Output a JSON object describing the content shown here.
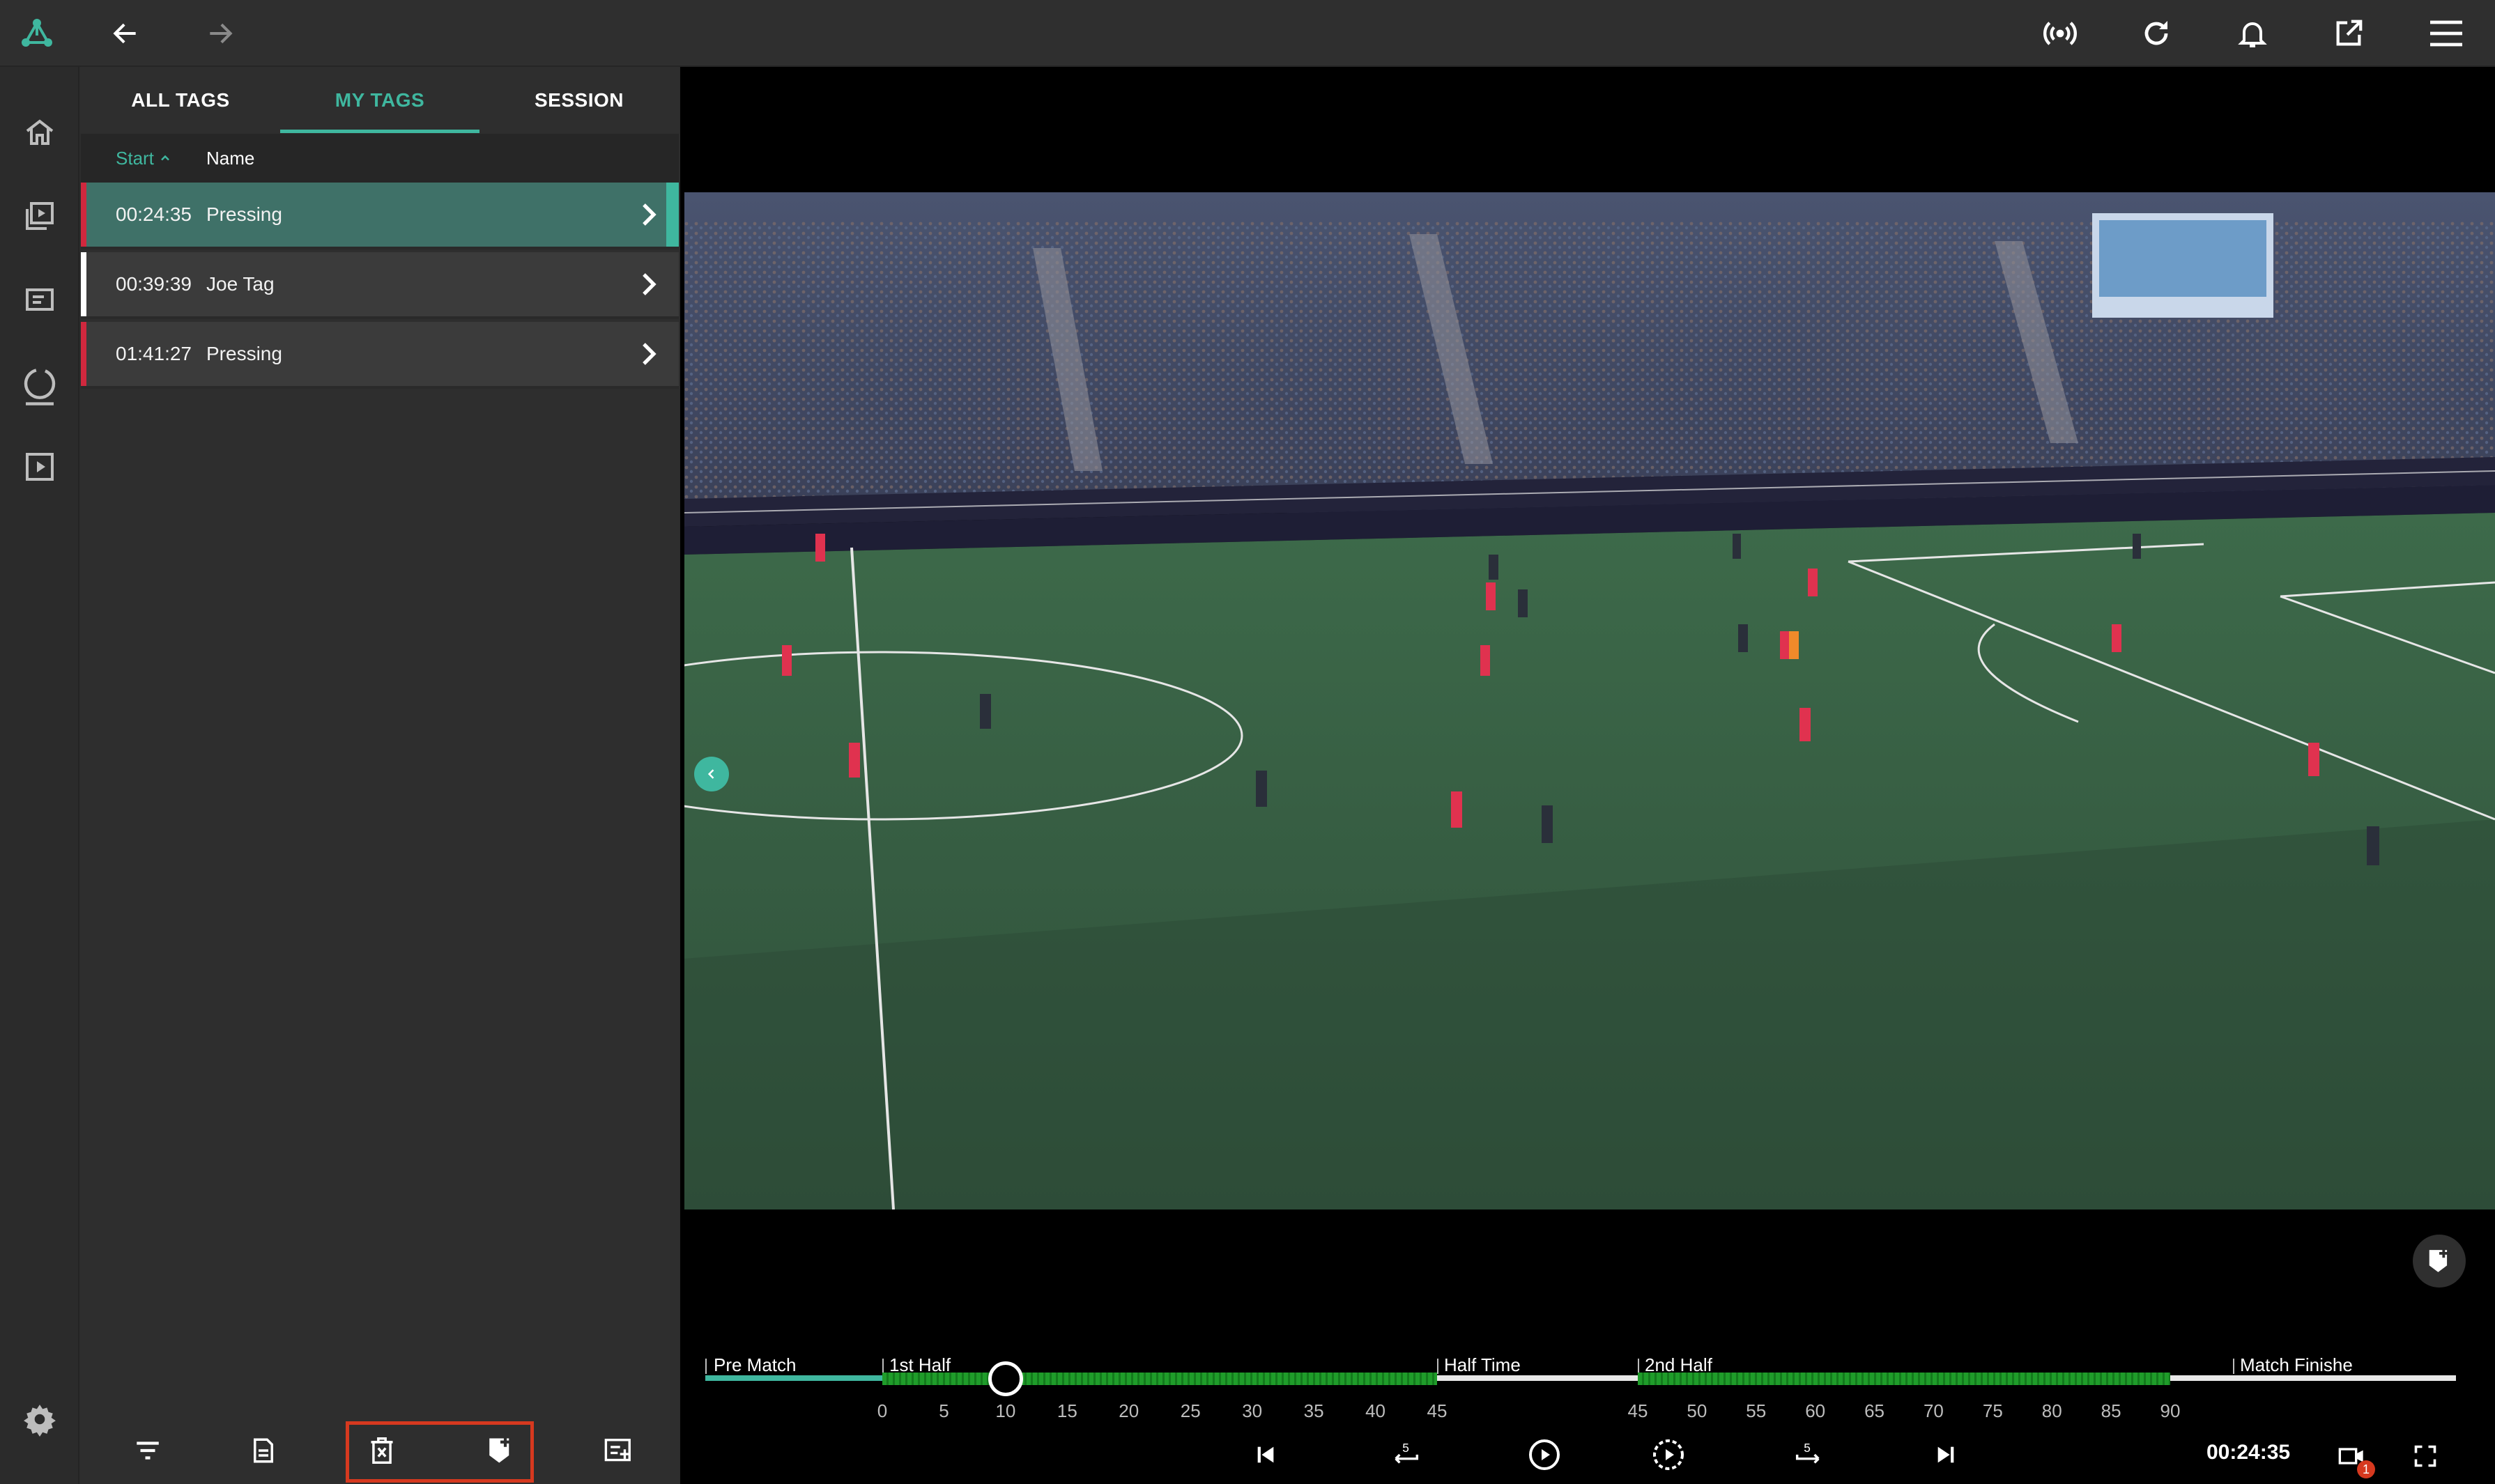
{
  "nav": {
    "logo": "logo-icon",
    "back": "arrow-left-icon",
    "forward": "arrow-right-icon",
    "right_icons": [
      "broadcast-icon",
      "refresh-icon",
      "bell-icon",
      "external-link-icon",
      "menu-icon"
    ]
  },
  "rail": {
    "items": [
      "home-icon",
      "video-library-icon",
      "playlist-icon",
      "sync-icon",
      "play-box-icon"
    ],
    "settings": "gear-icon"
  },
  "tabs": [
    {
      "label": "ALL TAGS",
      "active": false
    },
    {
      "label": "MY TAGS",
      "active": true
    },
    {
      "label": "SESSION",
      "active": false
    }
  ],
  "columns": {
    "start": "Start",
    "name": "Name"
  },
  "tags": [
    {
      "time": "00:24:35",
      "name": "Pressing",
      "color": "#d0283e",
      "selected": true
    },
    {
      "time": "00:39:39",
      "name": "Joe Tag",
      "color": "#ffffff",
      "selected": false
    },
    {
      "time": "01:41:27",
      "name": "Pressing",
      "color": "#d0283e",
      "selected": false
    }
  ],
  "panel_toolbar": [
    "filter-icon",
    "document-icon",
    "delete-tag-icon",
    "add-tag-icon",
    "add-to-playlist-icon"
  ],
  "timeline": {
    "segments": [
      "Pre Match",
      "1st Half",
      "Half Time",
      "2nd Half",
      "Match Finishe"
    ],
    "first_half_ticks": [
      "0",
      "5",
      "10",
      "15",
      "20",
      "25",
      "30",
      "35",
      "40",
      "45"
    ],
    "second_half_ticks": [
      "45",
      "50",
      "55",
      "60",
      "65",
      "70",
      "75",
      "80",
      "85",
      "90"
    ],
    "progress_minute": 10
  },
  "player": {
    "current_time": "00:24:35",
    "camera_badge": "1",
    "controls": [
      "skip-previous-icon",
      "rewind-5-icon",
      "play-icon",
      "slow-motion-icon",
      "forward-5-icon",
      "skip-next-icon"
    ]
  },
  "colors": {
    "accent": "#3fb79f",
    "tag_red": "#d0283e",
    "highlight": "#d6391f"
  }
}
